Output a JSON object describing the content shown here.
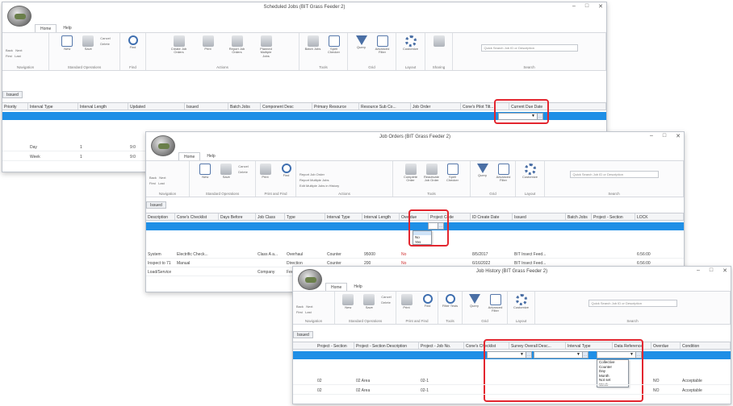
{
  "windows": [
    {
      "id": "w1",
      "title": "Scheduled Jobs (BIT Grass Feeder 2)",
      "tabs": [
        "Home",
        "Help"
      ],
      "ribbon_groups": [
        {
          "label": "Navigation",
          "small": [
            "Back",
            "Next",
            "First",
            "Last"
          ]
        },
        {
          "label": "Standard Operations",
          "buttons": [
            "New",
            "Save"
          ],
          "small": [
            "Cancel",
            "Delete"
          ]
        },
        {
          "label": "Find",
          "buttons": [
            "Find"
          ]
        },
        {
          "label": "Actions",
          "buttons": [
            "Create Job Orders",
            "Print",
            "Report Job Orders",
            "Planned Multiple Jobs"
          ]
        },
        {
          "label": "Tools",
          "buttons": [
            "Batch Jobs",
            "Spell Checker"
          ]
        },
        {
          "label": "Grid",
          "buttons": [
            "Query",
            "Advanced Filter"
          ]
        },
        {
          "label": "Layout",
          "buttons": [
            "Customize"
          ]
        },
        {
          "label": "Sharing",
          "buttons": [
            ""
          ]
        },
        {
          "label": "Search",
          "search_placeholder": "Quick Search Job ID or Description"
        }
      ],
      "subtab": "Issued",
      "columns": [
        "Priority",
        "Interval Type",
        "Interval Length",
        "Updated",
        "Issued",
        "Batch Jobs",
        "Component Desc",
        "Primary Resource",
        "Resource Sub Co...",
        "Job Order",
        "Cone's Pilot Tilt...",
        "Current Due Date"
      ],
      "rows": [
        [
          "",
          "Day",
          "1",
          "9:0"
        ],
        [
          "",
          "Week",
          "1",
          "9:0"
        ]
      ]
    },
    {
      "id": "w2",
      "title": "Job Orders (BIT Grass Feeder 2)",
      "tabs": [
        "Home",
        "Help"
      ],
      "ribbon_groups": [
        {
          "label": "Navigation",
          "small": [
            "Back",
            "Next",
            "First",
            "Last"
          ]
        },
        {
          "label": "Standard Operations",
          "buttons": [
            "New",
            "Save"
          ],
          "small": [
            "Cancel",
            "Delete"
          ]
        },
        {
          "label": "Print and Find",
          "buttons": [
            "Print",
            "Find"
          ]
        },
        {
          "label": "Actions",
          "small": [
            "Report Job Order",
            "Report Multiple Jobs",
            "Edit Multiple Jobs in History"
          ]
        },
        {
          "label": "Tools",
          "buttons": [
            "Complete Order",
            "Reactivate Job Order",
            "Spell Checker"
          ]
        },
        {
          "label": "Grid",
          "buttons": [
            "Query",
            "Advanced Filter"
          ]
        },
        {
          "label": "Layout",
          "buttons": [
            "Customize"
          ]
        },
        {
          "label": "Search",
          "search_placeholder": "Quick Search Job ID or Description"
        }
      ],
      "subtab": "Issued",
      "columns": [
        "Description",
        "Cone's Checklist",
        "Days Before",
        "Job Class",
        "Type",
        "Interval Type",
        "Interval Length",
        "Overdue",
        "Project Code",
        "ID Create Date",
        "Issued",
        "Batch Jobs",
        "Project - Section",
        "LOCK"
      ],
      "dropdown_options": [
        "",
        "No",
        "Yes"
      ],
      "rows": [
        [
          "System",
          "Electrific Check...",
          "",
          "Class A a...",
          "Overhaul",
          "Counter",
          "95000",
          "No",
          "",
          "8/5/2017",
          "BIT Insect Feed...",
          "",
          "",
          "6:56:00"
        ],
        [
          "Inspect to 71",
          "Manual",
          "",
          "",
          "Direction",
          "Counter",
          "200",
          "No",
          "",
          "6/16/2022",
          "BIT Insect Feed...",
          "",
          "",
          "6:56:00"
        ],
        [
          "Load/Service",
          "",
          "",
          "Company",
          "Feeder",
          "",
          "",
          "",
          "",
          "",
          "",
          "",
          "",
          ""
        ]
      ]
    },
    {
      "id": "w3",
      "title": "Job History (BIT Grass Feeder 2)",
      "tabs": [
        "Home",
        "Help"
      ],
      "ribbon_groups": [
        {
          "label": "Navigation",
          "small": [
            "Back",
            "Next",
            "First",
            "Last"
          ]
        },
        {
          "label": "Standard Operations",
          "buttons": [
            "New",
            "Save"
          ],
          "small": [
            "Cancel",
            "Delete"
          ]
        },
        {
          "label": "Print and Find",
          "buttons": [
            "Print",
            "Find"
          ]
        },
        {
          "label": "Tools",
          "buttons": [
            "Filter Tests"
          ]
        },
        {
          "label": "Grid",
          "buttons": [
            "Query",
            "Advanced Filter"
          ]
        },
        {
          "label": "Layout",
          "buttons": [
            "Customize"
          ]
        },
        {
          "label": "Search",
          "search_placeholder": "Quick Search Job ID or Description"
        }
      ],
      "subtab": "Issued",
      "columns": [
        "Project - Section",
        "Project - Section Description",
        "Project - Job No.",
        "Cone's Checklist",
        "Survey Overall Desc...",
        "Interval Type",
        "Data Reference",
        "Overdue",
        "Condition"
      ],
      "dropdown_options": [
        "Collective",
        "Counter",
        "Day",
        "Month",
        "Not set",
        "Week"
      ],
      "rows": [
        [
          "02",
          "02 Area",
          "02-1",
          "",
          "",
          "",
          "",
          "NO",
          "Acceptable"
        ],
        [
          "02",
          "02 Area",
          "02-1",
          "",
          "",
          "",
          "",
          "NO",
          "Acceptable"
        ]
      ]
    }
  ],
  "colors": {
    "selection_blue": "#1f8fe6",
    "highlight_red": "#e3262f"
  },
  "icons": {
    "app": "app-logo-icon",
    "close": "close-icon",
    "maximize": "maximize-icon",
    "minimize": "minimize-icon"
  },
  "glyphs": {
    "minimize": "–",
    "maximize": "□",
    "close": "✕",
    "dd_arrow": "▼",
    "dd_btn": "…"
  }
}
